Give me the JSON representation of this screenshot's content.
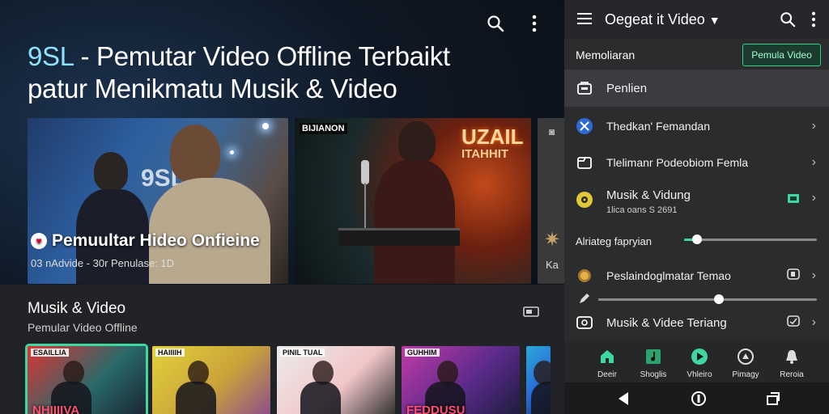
{
  "app": {
    "title_brand": "9SL",
    "title_line1_rest": " - Pemutar Video Offline Terbaikt",
    "title_line2": "patur Menikmatu Musik & Video"
  },
  "featured": {
    "card1_title": "Pemuultar Hideo Onfieine",
    "card1_meta": "03 nAdvide - 30r  Penulase:  1D",
    "card1_poster": "9SL",
    "card2_poster_small": "BIJIANON",
    "card2_poster_big1": "UZAIL",
    "card2_poster_big2": "ITAHHIT",
    "card3_label": "Ka"
  },
  "section": {
    "title": "Musik & Video",
    "subtitle": "Pemular Video Offline"
  },
  "thumbnails": [
    {
      "label": "ESAILLIA",
      "big": "NHIIIIVA",
      "colors": [
        "#d33",
        "#2a6a6a",
        "#1a2330"
      ]
    },
    {
      "label": "HAIIIIH",
      "big": "",
      "colors": [
        "#e3d23a",
        "#c9a23a",
        "#8a4a8e"
      ]
    },
    {
      "label": "PINIL TUAL",
      "big": "",
      "colors": [
        "#ececec",
        "#f1c6c8",
        "#2b2b2b"
      ]
    },
    {
      "label": "GUHHIM",
      "big": "FEDDUSU",
      "colors": [
        "#c23aa8",
        "#5a2a8a",
        "#1a1c3a"
      ]
    },
    {
      "label": "",
      "big": "",
      "colors": [
        "#2aa8d8",
        "#2a6ad8",
        "#1a2a5a"
      ]
    }
  ],
  "drawer": {
    "title": "Oegeat it Video",
    "subtitle": "Memoliaran",
    "button": "Pemula Video",
    "highlight_item": "Penlien",
    "item1": "Thedkan' Femandan",
    "item2": "Tlelimanr Podeobiom Femla",
    "item3": "Musik & Vidung",
    "item3_sub": "1lica oans S 2691",
    "slider1_label": "Alriateg fapryian",
    "slider1_value": 0.1,
    "item4": "Peslaindoglmatar Temao",
    "slider2_value": 0.55,
    "item5": "Musik & Videe Teriang",
    "accent": "#3fd6a0"
  },
  "bottom_nav": [
    {
      "label": "Deeir",
      "icon": "home-icon"
    },
    {
      "label": "Shoglis",
      "icon": "music-note-icon"
    },
    {
      "label": "Vhleiro",
      "icon": "play-icon"
    },
    {
      "label": "Pimagy",
      "icon": "disc-icon"
    },
    {
      "label": "Reroia",
      "icon": "bell-icon"
    }
  ]
}
